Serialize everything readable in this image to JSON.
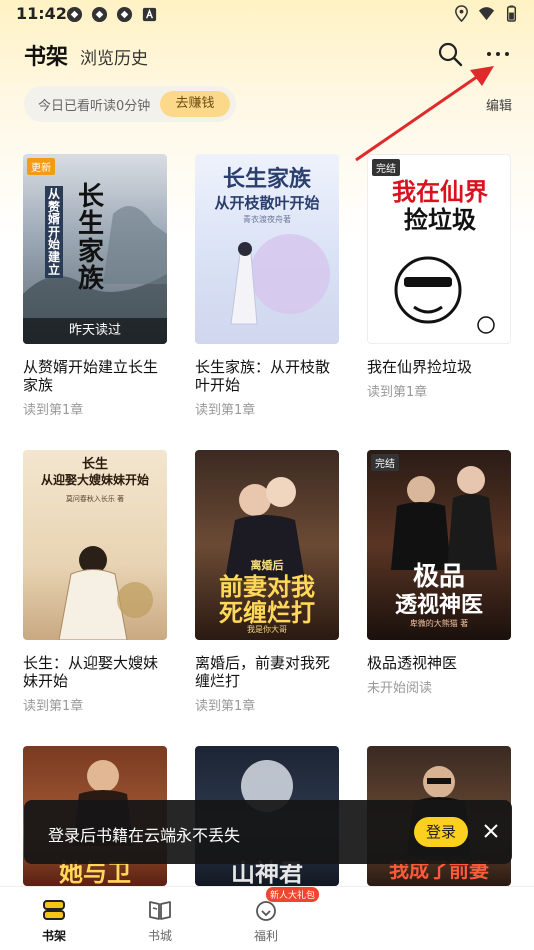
{
  "status_bar": {
    "time": "11:42"
  },
  "header": {
    "tab_shelf": "书架",
    "tab_history": "浏览历史",
    "edit": "编辑"
  },
  "reading": {
    "text": "今日已看听读0分钟",
    "earn": "去赚钱"
  },
  "books": [
    {
      "title": "从赘婿开始建立长生家族",
      "title_lines": [
        "从赘婿开始建立长生",
        "家族"
      ],
      "status": "读到第1章",
      "badge": "更新",
      "overlay": "昨天读过",
      "cover_title": "长生家族",
      "cover_sub": "从赘婿开始建立"
    },
    {
      "title": "长生家族：从开枝散叶开始",
      "title_lines": [
        "长生家族：从开枝散",
        "叶开始"
      ],
      "status": "读到第1章",
      "cover_title": "长生家族",
      "cover_sub": "从开枝散叶开始",
      "cover_author": "青衣渡夜舟著"
    },
    {
      "title": "我在仙界捡垃圾",
      "title_lines": [
        "我在仙界捡垃圾"
      ],
      "status": "读到第1章",
      "badge": "完结",
      "cover_title": "我在仙界",
      "cover_sub": "捡垃圾"
    },
    {
      "title": "长生：从迎娶大嫂妹妹开始",
      "title_lines": [
        "长生：从迎娶大嫂妹",
        "妹开始"
      ],
      "status": "读到第1章",
      "cover_title": "长生",
      "cover_sub": "从迎娶大嫂妹妹开始",
      "cover_author": "莫问春秋入长乐 著"
    },
    {
      "title": "离婚后，前妻对我死缠烂打",
      "title_lines": [
        "离婚后，前妻对我死",
        "缠烂打"
      ],
      "status": "读到第1章",
      "cover_title": "前妻对我",
      "cover_sub": "死缠烂打",
      "cover_tag": "离婚后",
      "cover_author": "我是你大哥"
    },
    {
      "title": "极品透视神医",
      "title_lines": [
        "极品透视神医"
      ],
      "status": "未开始阅读",
      "badge": "完结",
      "cover_title": "极品",
      "cover_sub": "透视神医",
      "cover_author": "卑微的大熊猫 著"
    },
    {
      "cover_title": "她与卫"
    },
    {
      "cover_title": "山神君"
    },
    {
      "cover_title": "我成了前妻"
    }
  ],
  "toast": {
    "text": "登录后书籍在云端永不丢失",
    "login": "登录"
  },
  "bottom_nav": {
    "shelf": "书架",
    "store": "书城",
    "welfare": "福利",
    "gift_badge": "新人大礼包"
  },
  "colors": {
    "accent": "#fcd01e",
    "pill_bg": "#f3f1ec",
    "earn_bg": "#fcd98a",
    "arrow": "#e0292b"
  }
}
